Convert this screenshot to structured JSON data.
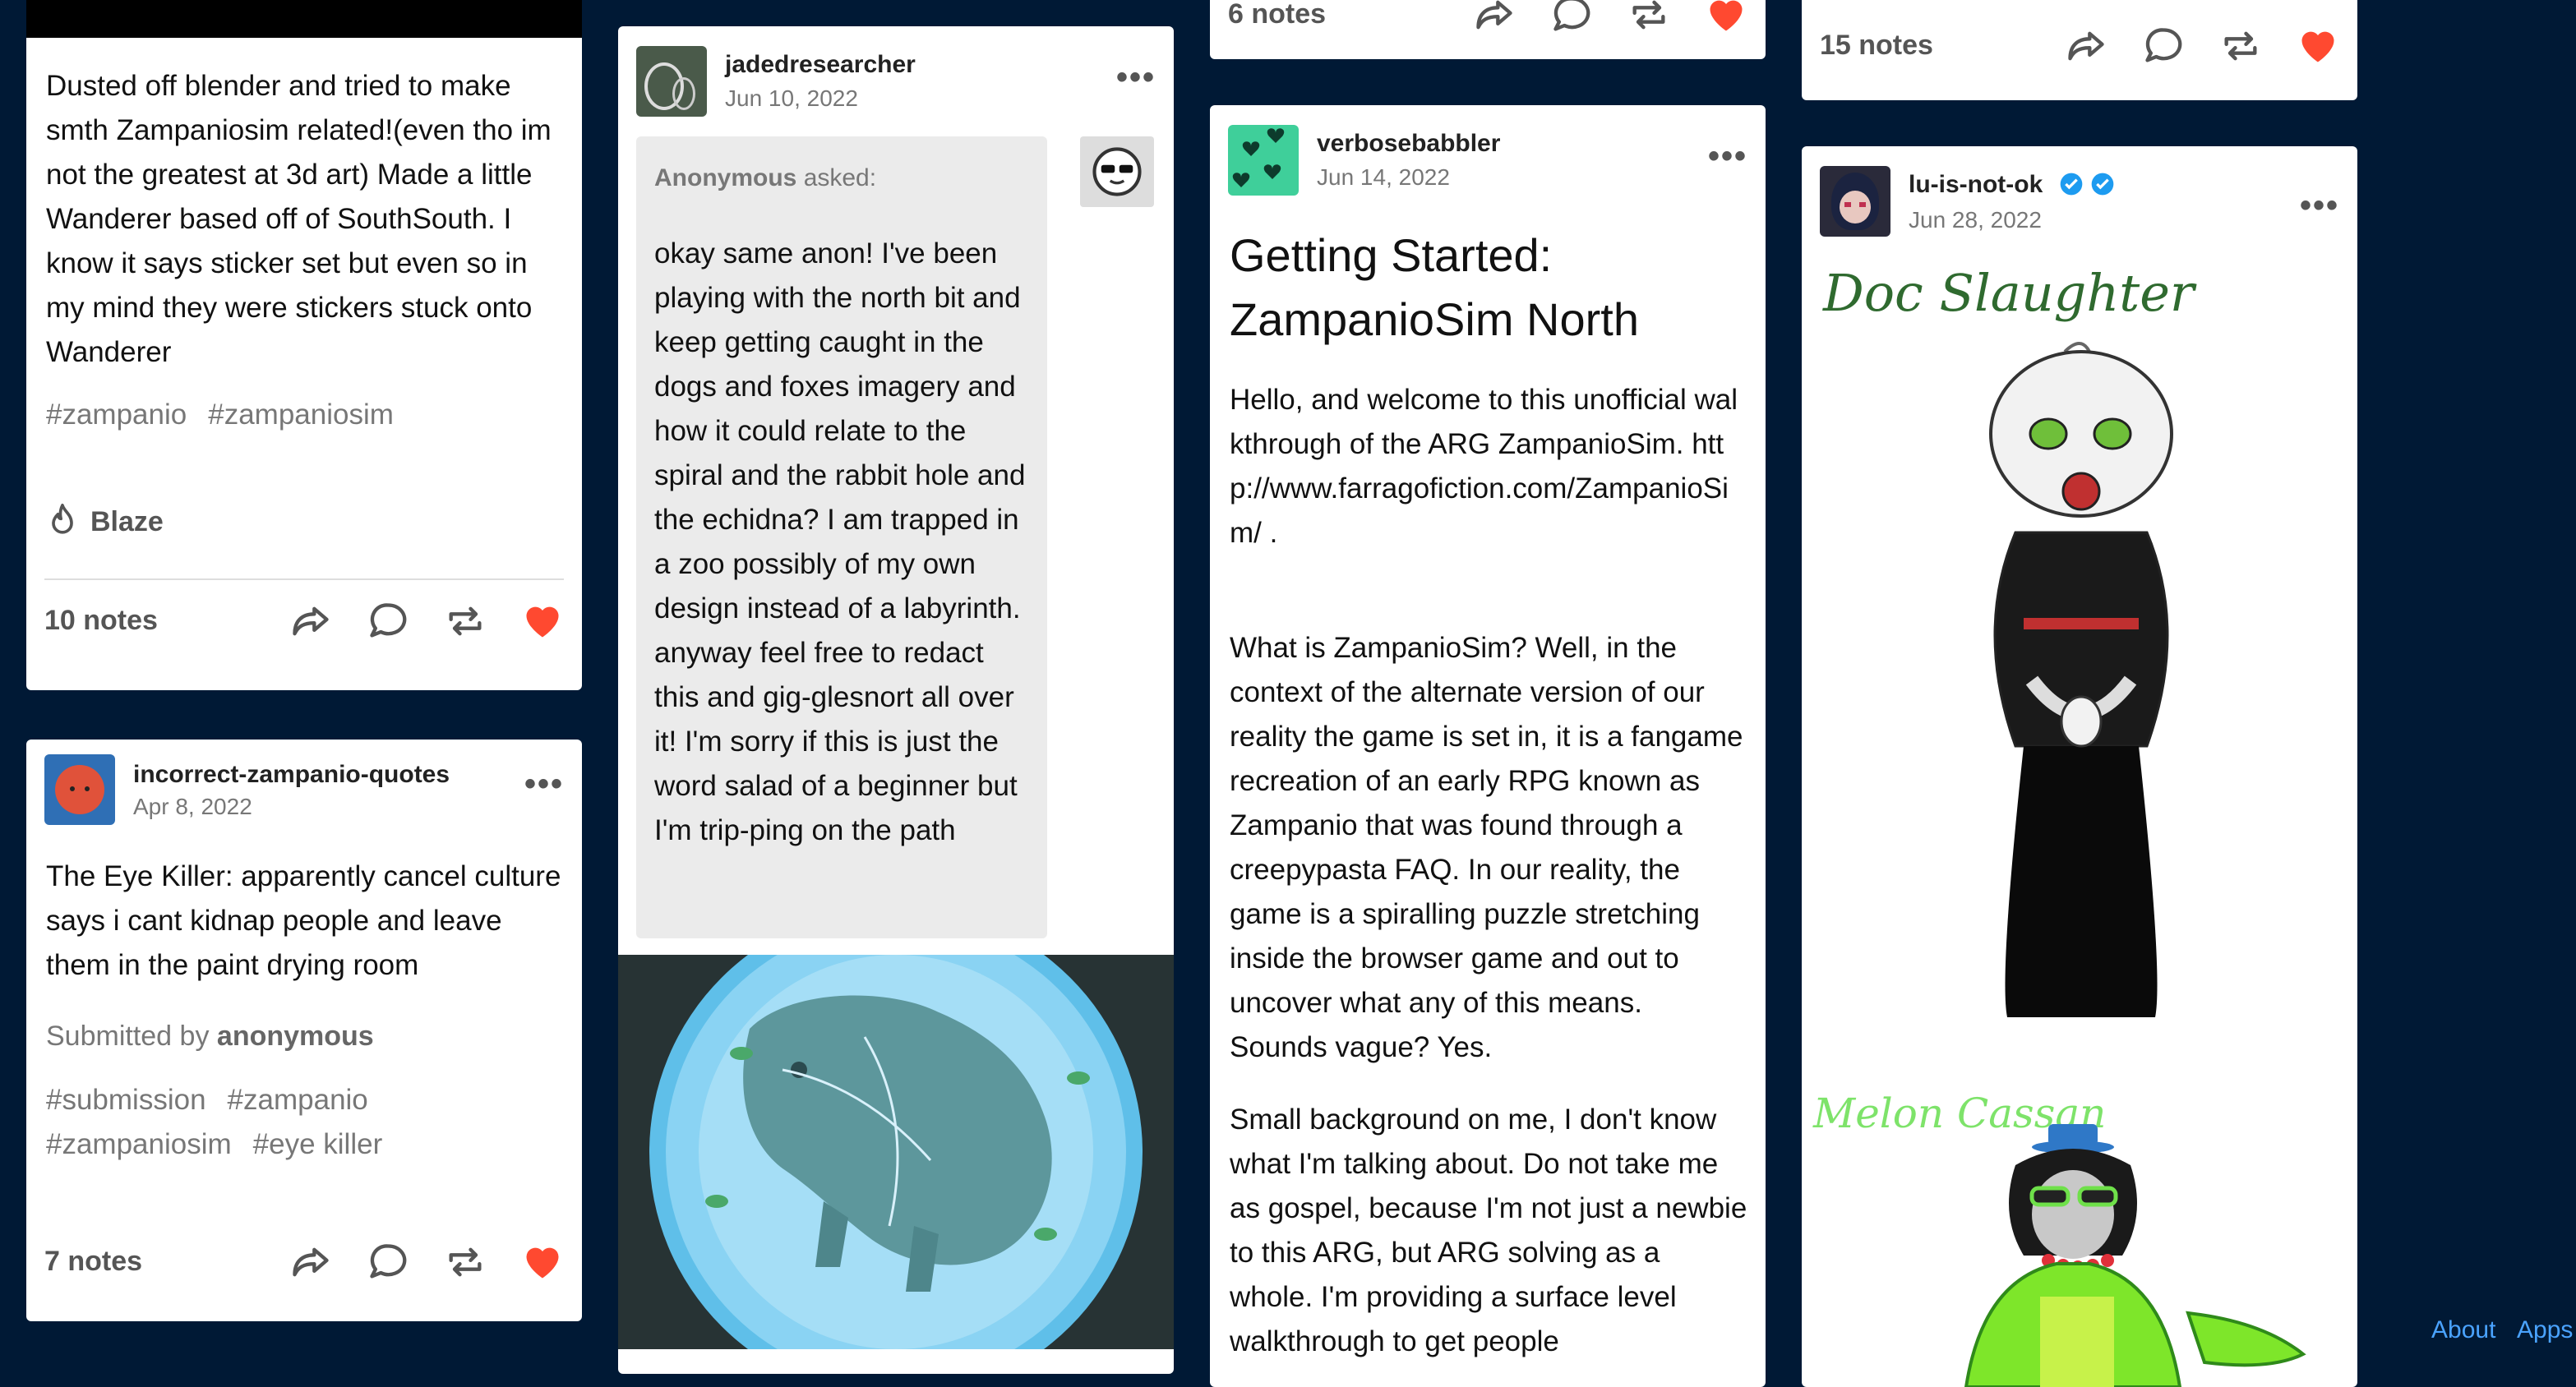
{
  "col1": {
    "post1": {
      "text": "Dusted off blender and tried to make smth Zampaniosim related!(even tho im not the greatest at 3d art) Made a little Wanderer based off of SouthSouth. I know it says sticker set but even so in my mind they were stickers stuck onto Wanderer",
      "tags": [
        "#zampanio",
        "#zampaniosim"
      ],
      "blaze": "Blaze",
      "notes": "10 notes"
    },
    "post2": {
      "username": "incorrect-zampanio-quotes",
      "date": "Apr 8, 2022",
      "text": "The Eye Killer: apparently cancel culture says i cant kidnap people and leave them in the paint drying room",
      "submitted_prefix": "Submitted by",
      "submitted_by": "anonymous",
      "tags": [
        "#submission",
        "#zampanio",
        "#zampaniosim",
        "#eye killer"
      ],
      "notes": "7 notes"
    }
  },
  "col2": {
    "post1": {
      "username": "jadedresearcher",
      "date": "Jun 10, 2022",
      "asker": "Anonymous",
      "asked": "asked:",
      "question": "okay same anon! I've been playing with the north bit and keep getting caught in the dogs and foxes imagery and how it could relate to the spiral and the rabbit hole and the echidna? I am trapped in a zoo possibly of my own design instead of a labyrinth. anyway feel free to redact this and gig-glesnort all over it! I'm sorry if this is just the word salad of a beginner but I'm trip-ping on the path"
    }
  },
  "col3": {
    "prev_notes": "6 notes",
    "post1": {
      "username": "verbosebabbler",
      "date": "Jun 14, 2022",
      "title": "Getting Started: ZampanioSim North",
      "p1": "Hello, and welcome to this unofficial walkthrough of the ARG ZampanioSim. http://www.farragofiction.com/ZampanioSim/ .",
      "p2": "What is ZampanioSim? Well, in the context of the alternate version of our reality the game is set in, it is a fangame recreation of an early RPG known as Zampanio that was found through a creepypasta FAQ. In our reality, the game is a spiralling puzzle stretching inside the browser game and out to uncover what any of this means. Sounds vague? Yes.",
      "p3": "Small background on me, I don't know what I'm talking about. Do not take me as gospel, because I'm not just a newbie to this ARG, but ARG solving as a whole. I'm providing a surface level walkthrough to get people"
    }
  },
  "col4": {
    "prev_notes": "15 notes",
    "post1": {
      "username": "lu-is-not-ok",
      "date": "Jun 28, 2022",
      "art_label1": "Doc Slaughter",
      "art_label2": "Melon Cassan"
    }
  },
  "footer": {
    "about": "About",
    "apps": "Apps"
  },
  "colors": {
    "background": "#001935",
    "like": "#ff4930",
    "link": "#4aa3ff",
    "verified": "#1d9bf0"
  }
}
